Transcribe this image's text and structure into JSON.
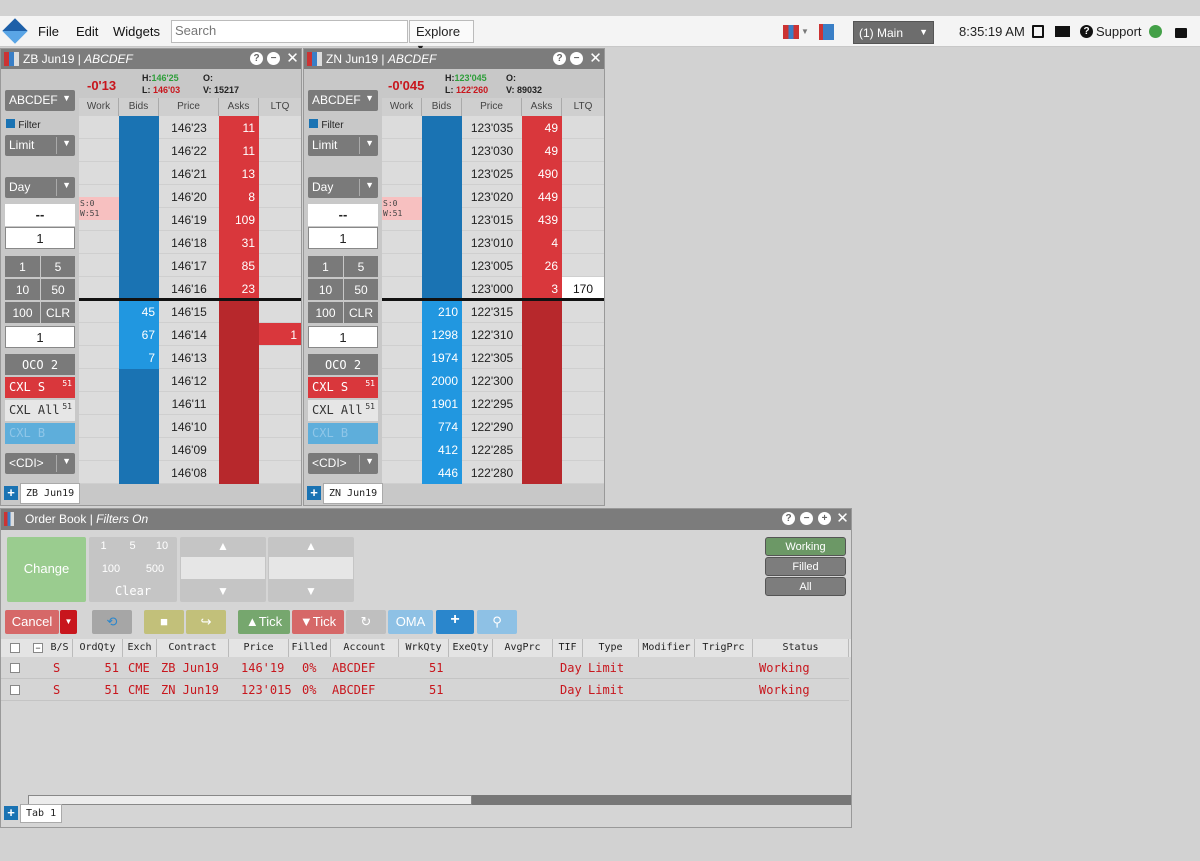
{
  "topbar": {
    "menus": [
      "File",
      "Edit",
      "Widgets"
    ],
    "search_placeholder": "Search",
    "explore_label": "Explore",
    "workspace_label": "(1) Main",
    "time": "8:35:19 AM",
    "support_label": "Support",
    "status_color": "#43a047"
  },
  "zb": {
    "title": "ZB Jun19",
    "account": "ABCDEF",
    "net_change": "-0'13",
    "high_label": "H:",
    "high": "146'25",
    "low_label": "L:",
    "low": "146'03",
    "open_label": "O:",
    "open": "",
    "vol_label": "V:",
    "volume": "15217",
    "account_select": "ABCDEF",
    "filter_label": "Filter",
    "order_type": "Limit",
    "tif": "Day",
    "price_field": "--",
    "qty_field": "1",
    "qty_buttons": [
      "1",
      "5",
      "10",
      "50",
      "100",
      "CLR"
    ],
    "qty_field2": "1",
    "oco_label": "OCO 2",
    "cxl_s_label": "CXL S",
    "cxl_s_count": "51",
    "cxl_all_label": "CXL All",
    "cxl_all_count": "51",
    "cxl_b_label": "CXL B",
    "cdi_label": "<CDI>",
    "headers": [
      "Work",
      "Bids",
      "Price",
      "Asks",
      "LTQ"
    ],
    "sw_lines": [
      "S:0",
      "W:51"
    ],
    "tab_label": "ZB Jun19",
    "rows": [
      {
        "price": "146'23",
        "bid": "",
        "ask": "11",
        "ltq": ""
      },
      {
        "price": "146'22",
        "bid": "",
        "ask": "11",
        "ltq": ""
      },
      {
        "price": "146'21",
        "bid": "",
        "ask": "13",
        "ltq": ""
      },
      {
        "price": "146'20",
        "bid": "",
        "ask": "8",
        "ltq": ""
      },
      {
        "price": "146'19",
        "bid": "",
        "ask": "109",
        "ltq": ""
      },
      {
        "price": "146'18",
        "bid": "",
        "ask": "31",
        "ltq": ""
      },
      {
        "price": "146'17",
        "bid": "",
        "ask": "85",
        "ltq": ""
      },
      {
        "price": "146'16",
        "bid": "",
        "ask": "23",
        "ltq": ""
      },
      {
        "price": "146'15",
        "bid": "45",
        "ask": "",
        "ltq": ""
      },
      {
        "price": "146'14",
        "bid": "67",
        "ask": "",
        "ltq": "1"
      },
      {
        "price": "146'13",
        "bid": "7",
        "ask": "",
        "ltq": ""
      },
      {
        "price": "146'12",
        "bid": "",
        "ask": "",
        "ltq": ""
      },
      {
        "price": "146'11",
        "bid": "",
        "ask": "",
        "ltq": ""
      },
      {
        "price": "146'10",
        "bid": "",
        "ask": "",
        "ltq": ""
      },
      {
        "price": "146'09",
        "bid": "",
        "ask": "",
        "ltq": ""
      },
      {
        "price": "146'08",
        "bid": "",
        "ask": "",
        "ltq": ""
      }
    ]
  },
  "zn": {
    "title": "ZN Jun19",
    "account": "ABCDEF",
    "net_change": "-0'045",
    "high_label": "H:",
    "high": "123'045",
    "low_label": "L:",
    "low": "122'260",
    "open_label": "O:",
    "open": "",
    "vol_label": "V:",
    "volume": "89032",
    "account_select": "ABCDEF",
    "filter_label": "Filter",
    "order_type": "Limit",
    "tif": "Day",
    "price_field": "--",
    "qty_field": "1",
    "qty_buttons": [
      "1",
      "5",
      "10",
      "50",
      "100",
      "CLR"
    ],
    "qty_field2": "1",
    "oco_label": "OCO 2",
    "cxl_s_label": "CXL S",
    "cxl_s_count": "51",
    "cxl_all_label": "CXL All",
    "cxl_all_count": "51",
    "cxl_b_label": "CXL B",
    "cdi_label": "<CDI>",
    "headers": [
      "Work",
      "Bids",
      "Price",
      "Asks",
      "LTQ"
    ],
    "sw_lines": [
      "S:0",
      "W:51"
    ],
    "tab_label": "ZN Jun19",
    "rows": [
      {
        "price": "123'035",
        "bid": "",
        "ask": "49",
        "ltq": ""
      },
      {
        "price": "123'030",
        "bid": "",
        "ask": "49",
        "ltq": ""
      },
      {
        "price": "123'025",
        "bid": "",
        "ask": "490",
        "ltq": ""
      },
      {
        "price": "123'020",
        "bid": "",
        "ask": "449",
        "ltq": ""
      },
      {
        "price": "123'015",
        "bid": "",
        "ask": "439",
        "ltq": ""
      },
      {
        "price": "123'010",
        "bid": "",
        "ask": "4",
        "ltq": ""
      },
      {
        "price": "123'005",
        "bid": "",
        "ask": "26",
        "ltq": ""
      },
      {
        "price": "123'000",
        "bid": "",
        "ask": "3",
        "ltq": "170"
      },
      {
        "price": "122'315",
        "bid": "210",
        "ask": "",
        "ltq": ""
      },
      {
        "price": "122'310",
        "bid": "1298",
        "ask": "",
        "ltq": ""
      },
      {
        "price": "122'305",
        "bid": "1974",
        "ask": "",
        "ltq": ""
      },
      {
        "price": "122'300",
        "bid": "2000",
        "ask": "",
        "ltq": ""
      },
      {
        "price": "122'295",
        "bid": "1901",
        "ask": "",
        "ltq": ""
      },
      {
        "price": "122'290",
        "bid": "774",
        "ask": "",
        "ltq": ""
      },
      {
        "price": "122'285",
        "bid": "412",
        "ask": "",
        "ltq": ""
      },
      {
        "price": "122'280",
        "bid": "446",
        "ask": "",
        "ltq": ""
      }
    ]
  },
  "orderbook": {
    "title": "Order Book",
    "filter_status": "Filters On",
    "change_label": "Change",
    "qty_buttons": [
      "1",
      "5",
      "10",
      "100",
      "500"
    ],
    "clear_label": "Clear",
    "filter_buttons": [
      "Working",
      "Filled",
      "All"
    ],
    "cancel_label": "Cancel",
    "tick_up_label": "Tick",
    "tick_down_label": "Tick",
    "oma_label": "OMA",
    "headers": [
      "B/S",
      "OrdQty",
      "Exch",
      "Contract",
      "Price",
      "Filled",
      "Account",
      "WrkQty",
      "ExeQty",
      "AvgPrc",
      "TIF",
      "Type",
      "Modifier",
      "TrigPrc",
      "Status"
    ],
    "rows": [
      {
        "bs": "S",
        "qty": "51",
        "exch": "CME",
        "contract": "ZB Jun19",
        "price": "146'19",
        "filled": "0%",
        "account": "ABCDEF",
        "wrk": "51",
        "tif": "Day",
        "type": "Limit",
        "status": "Working"
      },
      {
        "bs": "S",
        "qty": "51",
        "exch": "CME",
        "contract": "ZN Jun19",
        "price": "123'015",
        "filled": "0%",
        "account": "ABCDEF",
        "wrk": "51",
        "tif": "Day",
        "type": "Limit",
        "status": "Working"
      }
    ],
    "tab_label": "Tab 1"
  }
}
